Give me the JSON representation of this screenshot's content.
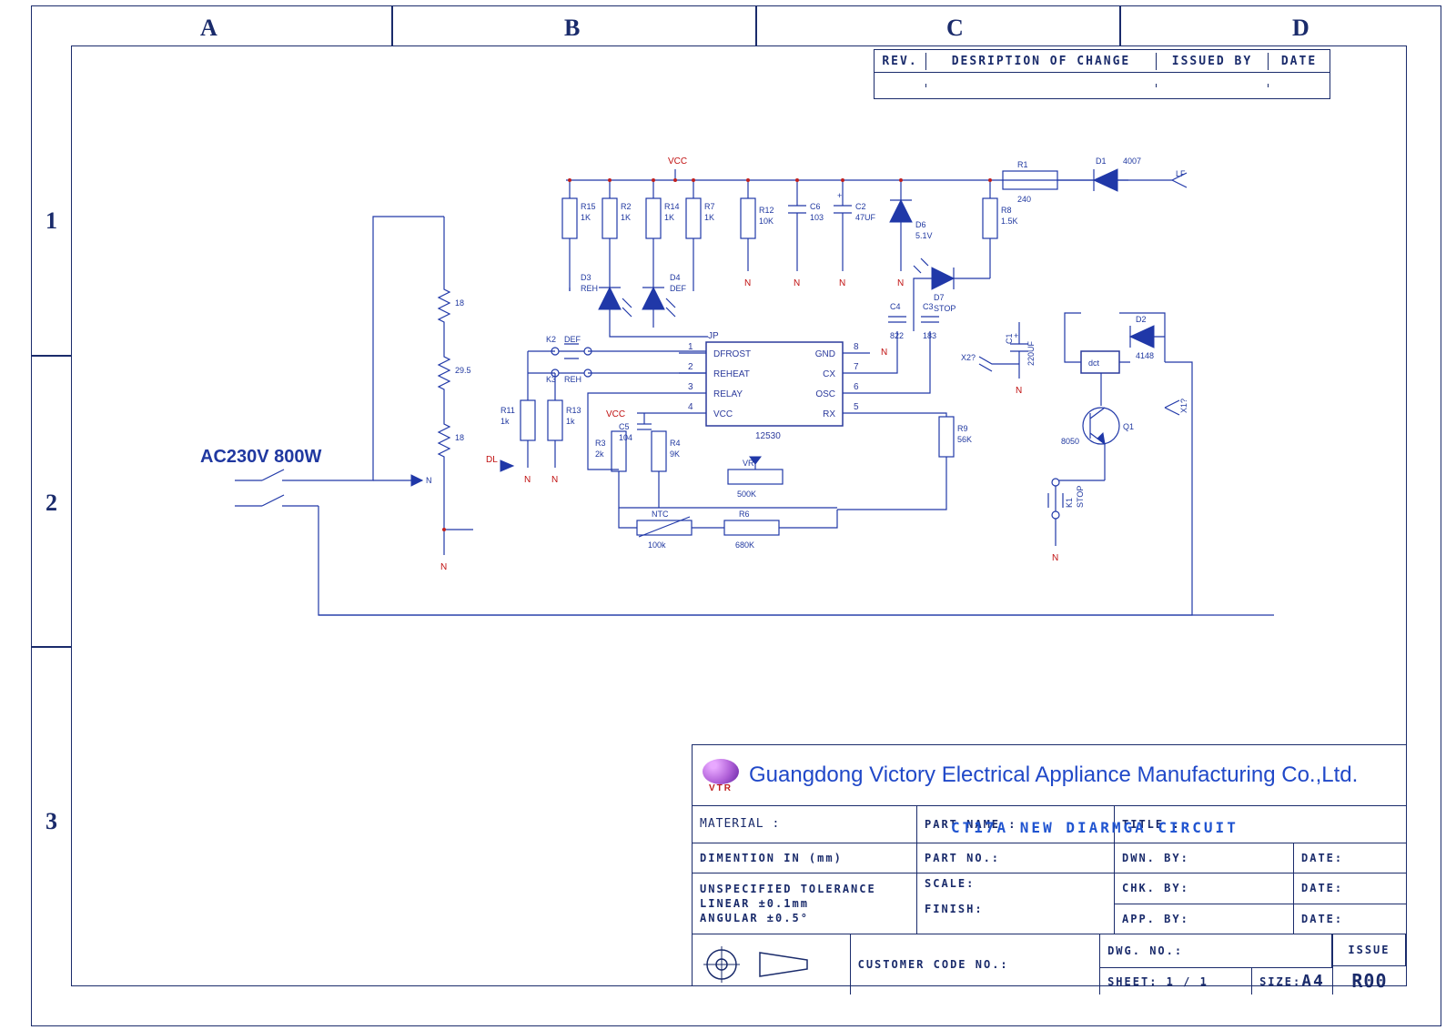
{
  "zones": {
    "letters": [
      "A",
      "B",
      "C",
      "D"
    ],
    "numbers": [
      "1",
      "2",
      "3"
    ]
  },
  "rev_block": {
    "headers": {
      "rev": "REV.",
      "desc": "DESRIPTION OF CHANGE",
      "issued": "ISSUED BY",
      "date": "DATE"
    }
  },
  "power": {
    "ac_label": "AC230V  800W",
    "heater": {
      "top": "18",
      "mid": "29.5",
      "bot": "18"
    },
    "dl": "DL"
  },
  "vcc": "VCC",
  "n_label": "N",
  "ic": {
    "ref": "JP",
    "part": "12530",
    "pins": {
      "p1": "DFROST",
      "p2": "REHEAT",
      "p3": "RELAY",
      "p4": "VCC",
      "p5": "RX",
      "p6": "OSC",
      "p7": "CX",
      "p8": "GND"
    },
    "nums": {
      "n1": "1",
      "n2": "2",
      "n3": "3",
      "n4": "4",
      "n5": "5",
      "n6": "6",
      "n7": "7",
      "n8": "8"
    }
  },
  "components": {
    "R1": {
      "ref": "R1",
      "val": "240"
    },
    "R2": {
      "ref": "R2",
      "val": "1K"
    },
    "R3": {
      "ref": "R3",
      "val": "2k"
    },
    "R4": {
      "ref": "R4",
      "val": "9K"
    },
    "R6": {
      "ref": "R6",
      "val": "680K"
    },
    "R7": {
      "ref": "R7",
      "val": "1K"
    },
    "R8": {
      "ref": "R8",
      "val": "1.5K"
    },
    "R9": {
      "ref": "R9",
      "val": "56K"
    },
    "R11": {
      "ref": "R11",
      "val": "1k"
    },
    "R12": {
      "ref": "R12",
      "val": "10K"
    },
    "R13": {
      "ref": "R13",
      "val": "1k"
    },
    "R14": {
      "ref": "R14",
      "val": "1K"
    },
    "R15": {
      "ref": "R15",
      "val": "1K"
    },
    "C1": {
      "ref": "C1",
      "val": "220UF"
    },
    "C2": {
      "ref": "C2",
      "val": "47UF"
    },
    "C3": {
      "ref": "C3",
      "val": "183"
    },
    "C4": {
      "ref": "C4",
      "val": "822"
    },
    "C5": {
      "ref": "C5",
      "val": "104"
    },
    "C6": {
      "ref": "C6",
      "val": "103"
    },
    "D1": {
      "ref": "D1",
      "val": "4007"
    },
    "D2": {
      "ref": "D2",
      "val": "4148"
    },
    "D3": {
      "ref": "D3",
      "val": "REH"
    },
    "D4": {
      "ref": "D4",
      "val": "DEF"
    },
    "D6": {
      "ref": "D6",
      "val": "5.1V"
    },
    "D7": {
      "ref": "D7",
      "val": "STOP"
    },
    "Q1": {
      "ref": "Q1",
      "val": "8050"
    },
    "K1": {
      "ref": "K1",
      "val": "STOP"
    },
    "K2": {
      "ref": "K2",
      "val": "DEF"
    },
    "K3": {
      "ref": "K3",
      "val": "REH"
    },
    "VR": {
      "ref": "VR",
      "val": "500K"
    },
    "NTC": {
      "ref": "NTC",
      "val": "100k"
    },
    "dct": "dct",
    "LF": "LF",
    "X1": "X1?",
    "X2": "X2?"
  },
  "titleblock": {
    "company": "Guangdong Victory Electrical Appliance Manufacturing Co.,Ltd.",
    "material_lbl": "MATERIAL :",
    "part_name_lbl": "PART NAME :",
    "title_lbl": "TITLE :",
    "part_name_val": "CT17A NEW DIARMGA CIRCUIT",
    "dimention": "DIMENTION IN (mm)",
    "part_no_lbl": "PART NO.:",
    "dwn_by": "DWN. BY:",
    "chk_by": "CHK. BY:",
    "app_by": "APP. BY:",
    "date": "DATE:",
    "unspec": "UNSPECIFIED TOLERANCE",
    "linear": "LINEAR        ±0.1mm",
    "angular": "ANGULAR    ±0.5°",
    "scale": "SCALE:",
    "finish": "FINISH:",
    "customer": "CUSTOMER CODE NO.:",
    "dwg_no": "DWG. NO.:",
    "sheet_lbl": "SHEET:",
    "sheet_val": "1 / 1",
    "size_lbl": "SIZE:",
    "size_val": "A4",
    "issue_lbl": "ISSUE",
    "issue_val": "R00"
  }
}
